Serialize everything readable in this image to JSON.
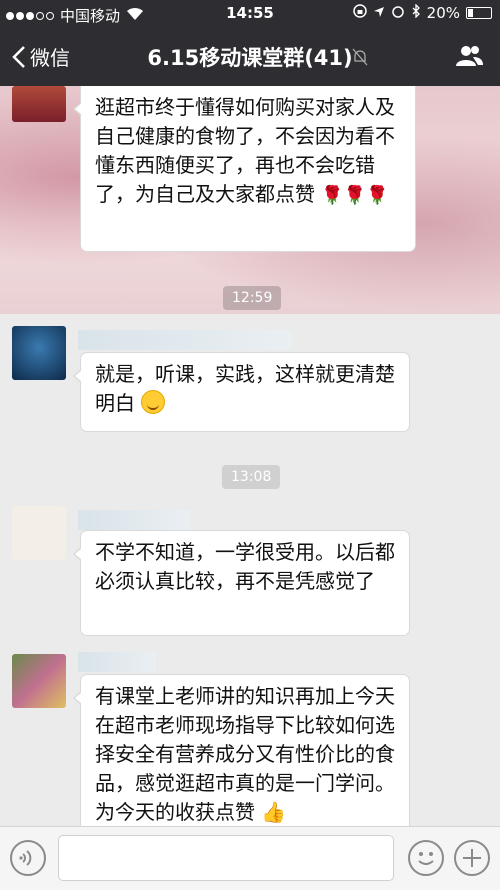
{
  "status_bar": {
    "carrier": "中国移动",
    "time": "14:55",
    "battery": "20%",
    "battery_level": 0.2
  },
  "nav": {
    "back_label": "微信",
    "title": "6.15移动课堂群(41)"
  },
  "messages": [
    {
      "text": "逛超市终于懂得如何购买对家人及自己健康的食物了，不会因为看不懂东西随便买了，再也不会吃错了，为自己及大家都点赞",
      "emoji": "rose-emoji ×3"
    },
    {
      "time": "12:59"
    },
    {
      "text": "就是，听课，实践，这样就更清楚明白",
      "emoji": "smile-emoji"
    },
    {
      "time": "13:08"
    },
    {
      "text": "不学不知道，一学很受用。以后都必须认真比较，再不是凭感觉了"
    },
    {
      "text": "有课堂上老师讲的知识再加上今天在超市老师现场指导下比较如何选择安全有营养成分又有性价比的食品，感觉逛超市真的是一门学问。为今天的收获点赞",
      "emoji": "thumbs-up-emoji"
    }
  ],
  "colors": {
    "nav_bg": "#2e2d32",
    "chat_bg": "#ebebeb",
    "bubble_bg": "#ffffff"
  }
}
